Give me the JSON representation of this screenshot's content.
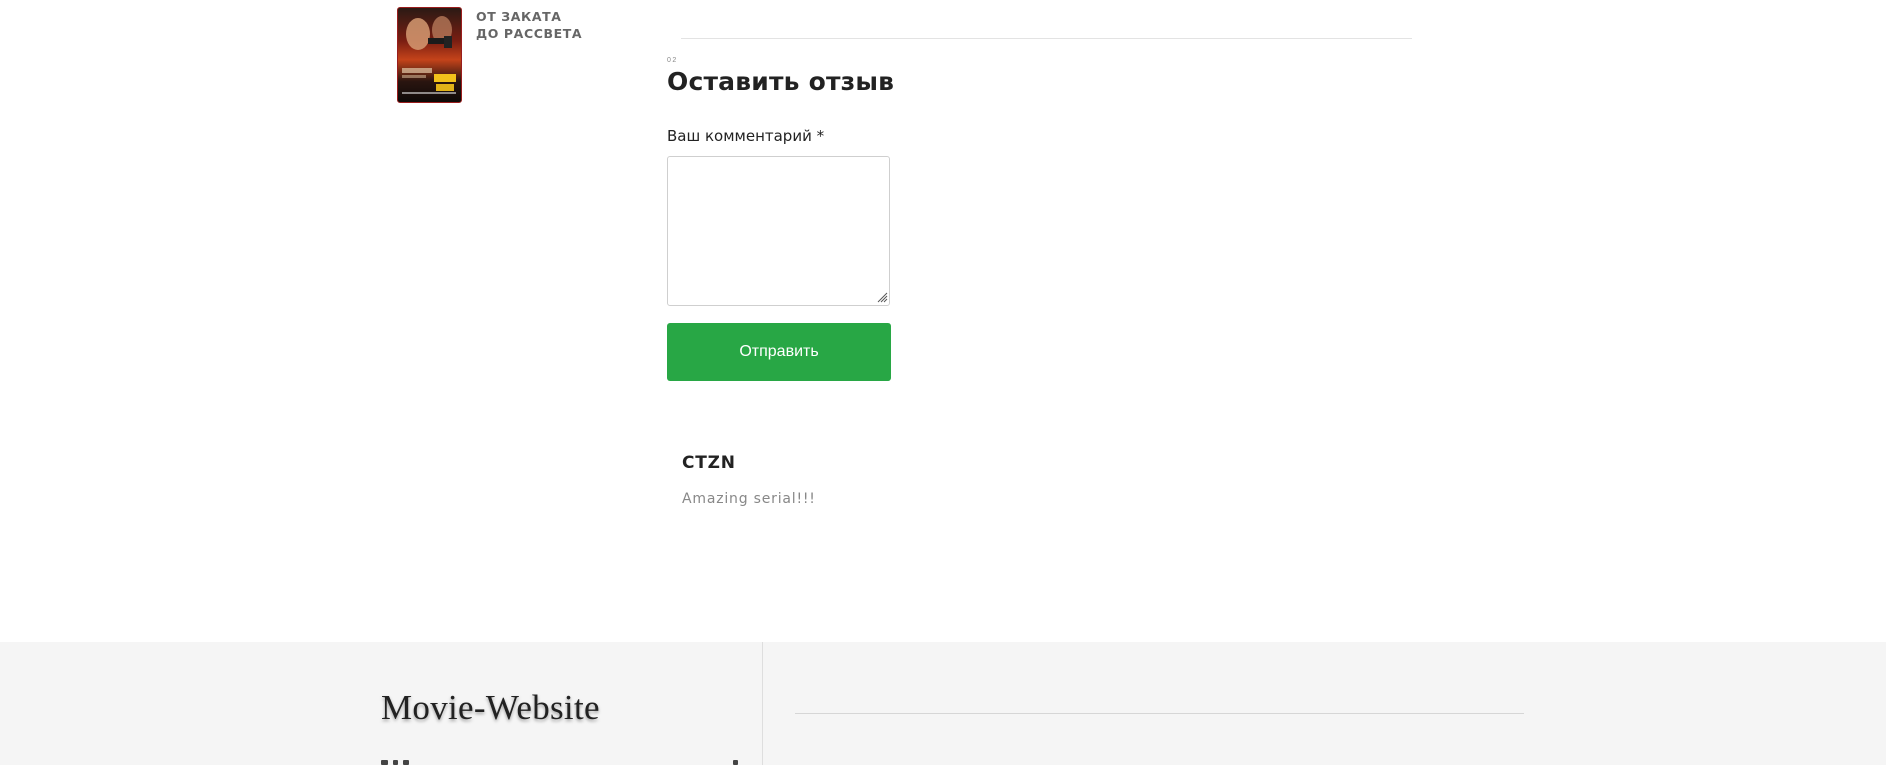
{
  "movie_card": {
    "title_line1": "ОТ ЗАКАТА",
    "title_line2": "ДО РАССВЕТА",
    "poster_icon": "movie-poster-image",
    "poster_colors": [
      "#2b1a14",
      "#c4431a",
      "#f2c21b"
    ]
  },
  "review_form": {
    "section_number": "02",
    "heading": "Оставить отзыв",
    "comment_label": "Ваш комментарий *",
    "comment_value": "",
    "submit_label": "Отправить",
    "submit_color": "#28a745"
  },
  "reviews": [
    {
      "author": "CTZN",
      "text": "Amazing serial!!!"
    }
  ],
  "footer": {
    "brand": "Movie-Website",
    "background": "#f5f5f5"
  }
}
